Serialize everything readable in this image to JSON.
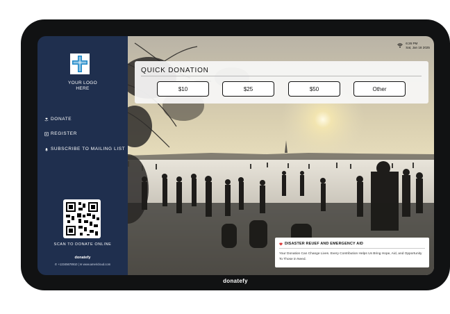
{
  "status": {
    "time": "6:26 PM",
    "date": "Sat, Jan 18 2025"
  },
  "sidebar": {
    "logo_lines": [
      "YOUR LOGO",
      "HERE"
    ],
    "nav": [
      {
        "label": "DONATE",
        "icon": "hand-heart-icon"
      },
      {
        "label": "REGISTER",
        "icon": "register-icon"
      },
      {
        "label": "SUBSCRIBE TO MAILING LIST",
        "icon": "bell-icon"
      }
    ],
    "scan_label": "SCAN TO DONATE ONLINE",
    "brand": "donatefy",
    "phone": "+12345678910",
    "website": "www.americloud.com"
  },
  "quick_donation": {
    "title": "QUICK DONATION",
    "amounts": [
      "$10",
      "$25",
      "$50",
      "Other"
    ]
  },
  "campaign": {
    "title": "DISASTER REUEF AND EMERGENCY AID",
    "text": "Your Donation Can Change Lives. Every Contribution Helps Us Bring Hope, Aid, and Opportunity To Those in Need."
  },
  "device_brand": "donatefy",
  "colors": {
    "sidebar": "#1f2f4e",
    "logo_blue": "#1e88c8",
    "device": "#111213"
  }
}
